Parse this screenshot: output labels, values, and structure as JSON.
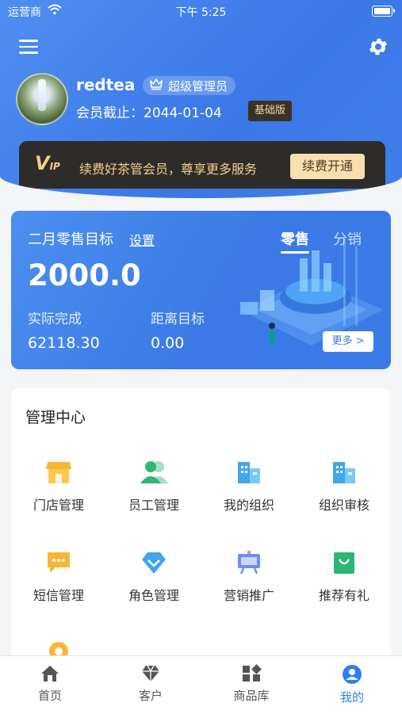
{
  "status_bar": {
    "carrier": "运营商",
    "time": "下午 5:25"
  },
  "profile": {
    "username": "redtea",
    "role_badge": "超级管理员",
    "member_until": "会员截止：2044-01-04",
    "plan_badge": "基础版"
  },
  "vip": {
    "logo": "V",
    "logo_small": "IP",
    "text": "续费好茶管会员，尊享更多服务",
    "button": "续费开通"
  },
  "target": {
    "title": "二月零售目标",
    "set_link": "设置",
    "tabs": [
      "零售",
      "分销"
    ],
    "active_tab": "零售",
    "amount": "2000.0",
    "actual_label": "实际完成",
    "actual_value": "62118.30",
    "remaining_label": "距离目标",
    "remaining_value": "0.00",
    "more_button": "更多 >"
  },
  "management": {
    "title": "管理中心",
    "items": [
      {
        "label": "门店管理",
        "icon": "store-icon",
        "color": "#f7b733"
      },
      {
        "label": "员工管理",
        "icon": "staff-icon",
        "color": "#2bb673"
      },
      {
        "label": "我的组织",
        "icon": "building-icon",
        "color": "#3fa7ea"
      },
      {
        "label": "组织审核",
        "icon": "building-audit-icon",
        "color": "#3fa7ea"
      },
      {
        "label": "短信管理",
        "icon": "sms-icon",
        "color": "#f7b733"
      },
      {
        "label": "角色管理",
        "icon": "diamond-icon",
        "color": "#3fa7ea"
      },
      {
        "label": "营销推广",
        "icon": "billboard-icon",
        "color": "#6c8ef5"
      },
      {
        "label": "推荐有礼",
        "icon": "gift-bag-icon",
        "color": "#2bb673"
      }
    ]
  },
  "tabbar": {
    "items": [
      {
        "label": "首页",
        "icon": "home-icon"
      },
      {
        "label": "客户",
        "icon": "diamond-icon"
      },
      {
        "label": "商品库",
        "icon": "grid-icon"
      },
      {
        "label": "我的",
        "icon": "user-icon"
      }
    ],
    "active": "我的",
    "active_color": "#2f7ff0"
  }
}
